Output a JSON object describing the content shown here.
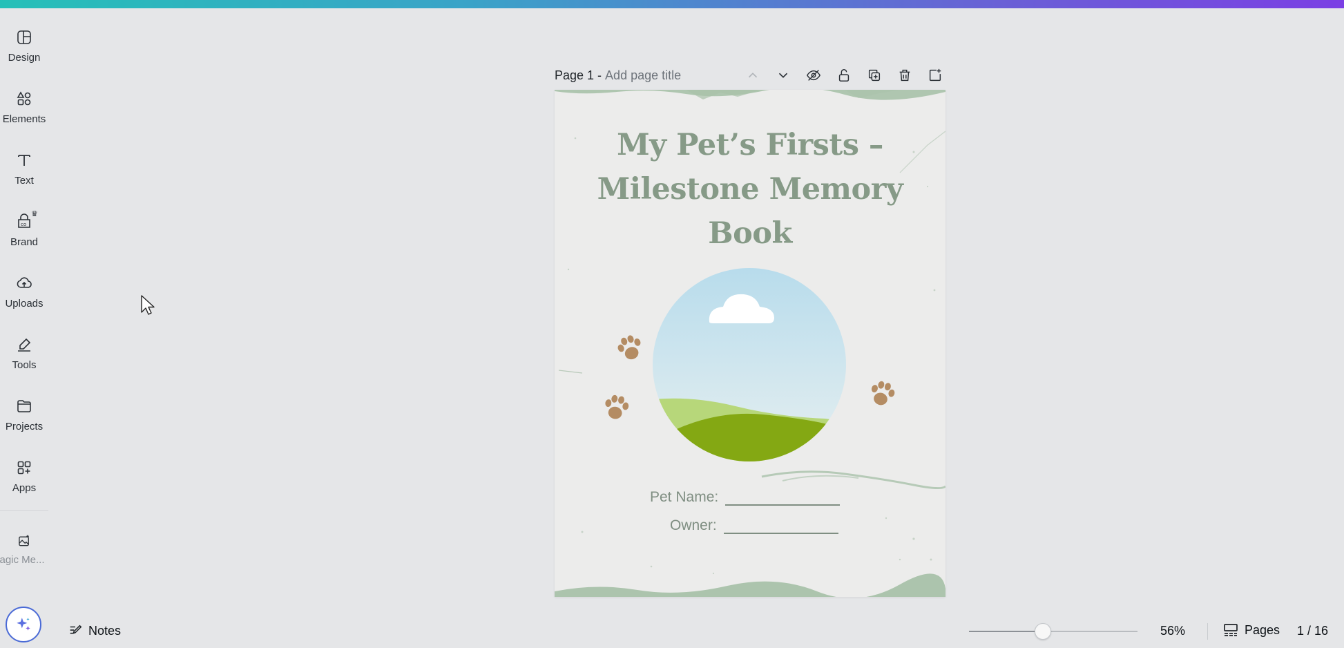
{
  "sidebar": {
    "items": [
      {
        "label": "Design",
        "icon": "design-icon"
      },
      {
        "label": "Elements",
        "icon": "elements-icon"
      },
      {
        "label": "Text",
        "icon": "text-icon"
      },
      {
        "label": "Brand",
        "icon": "brand-icon"
      },
      {
        "label": "Uploads",
        "icon": "uploads-icon"
      },
      {
        "label": "Tools",
        "icon": "tools-icon"
      },
      {
        "label": "Projects",
        "icon": "projects-icon"
      },
      {
        "label": "Apps",
        "icon": "apps-icon"
      },
      {
        "label": "agic Me...",
        "icon": "magic-media-icon"
      }
    ],
    "assistant_icon": "magic-sparkle-icon"
  },
  "page_header": {
    "page_label": "Page 1 -",
    "title_placeholder": "Add page title",
    "icons": [
      "chevron-up-icon",
      "chevron-down-icon",
      "eye-hide-icon",
      "lock-icon",
      "duplicate-icon",
      "trash-icon",
      "add-page-icon"
    ]
  },
  "design": {
    "title_line1": "My Pet’s Firsts –",
    "title_line2": "Milestone Memory",
    "title_line3": "Book",
    "pet_name_label": "Pet Name:",
    "owner_label": "Owner:",
    "colors": {
      "title": "#869a87",
      "paw": "#b48c63",
      "sky_top": "#b8dcec",
      "grass_dark": "#84a813",
      "grass_light": "#b7d77a",
      "texture": "#a9c2aa"
    }
  },
  "bottom_bar": {
    "notes_label": "Notes",
    "zoom_value": "56%",
    "zoom_level": 0.44,
    "pages_label": "Pages",
    "page_count": "1 / 16"
  },
  "theme": {
    "accent_gradient_start": "#25c0b8",
    "accent_gradient_end": "#7b3fe4",
    "workspace_bg": "#e5e6e8"
  }
}
